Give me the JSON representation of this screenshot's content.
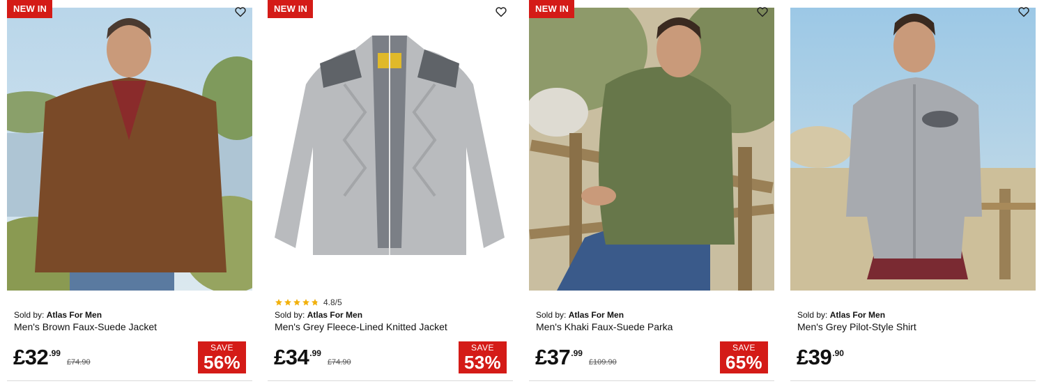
{
  "colors": {
    "badge": "#d41b17",
    "save": "#d41b17",
    "star": "#f2b10d"
  },
  "products": [
    {
      "badge": "NEW IN",
      "sold_by_label": "Sold by:",
      "seller": "Atlas For Men",
      "title": "Men's Brown Faux-Suede Jacket",
      "price_main": "£32",
      "price_pence": ".99",
      "was_price": "£74.90",
      "save_label": "SAVE",
      "save_pct": "56%",
      "image": "man-brown-suede-jacket-photo"
    },
    {
      "badge": "NEW IN",
      "rating": "4.8/5",
      "rating_stars": 4.8,
      "sold_by_label": "Sold by:",
      "seller": "Atlas For Men",
      "title": "Men's Grey Fleece-Lined Knitted Jacket",
      "price_main": "£34",
      "price_pence": ".99",
      "was_price": "£74.90",
      "save_label": "SAVE",
      "save_pct": "53%",
      "image": "grey-knitted-jacket-photo"
    },
    {
      "badge": "NEW IN",
      "sold_by_label": "Sold by:",
      "seller": "Atlas For Men",
      "title": "Men's Khaki Faux-Suede Parka",
      "price_main": "£37",
      "price_pence": ".99",
      "was_price": "£109.90",
      "save_label": "SAVE",
      "save_pct": "65%",
      "image": "man-khaki-parka-photo"
    },
    {
      "sold_by_label": "Sold by:",
      "seller": "Atlas For Men",
      "title": "Men's Grey Pilot-Style Shirt",
      "price_main": "£39",
      "price_pence": ".90",
      "image": "man-grey-shirt-photo"
    }
  ]
}
